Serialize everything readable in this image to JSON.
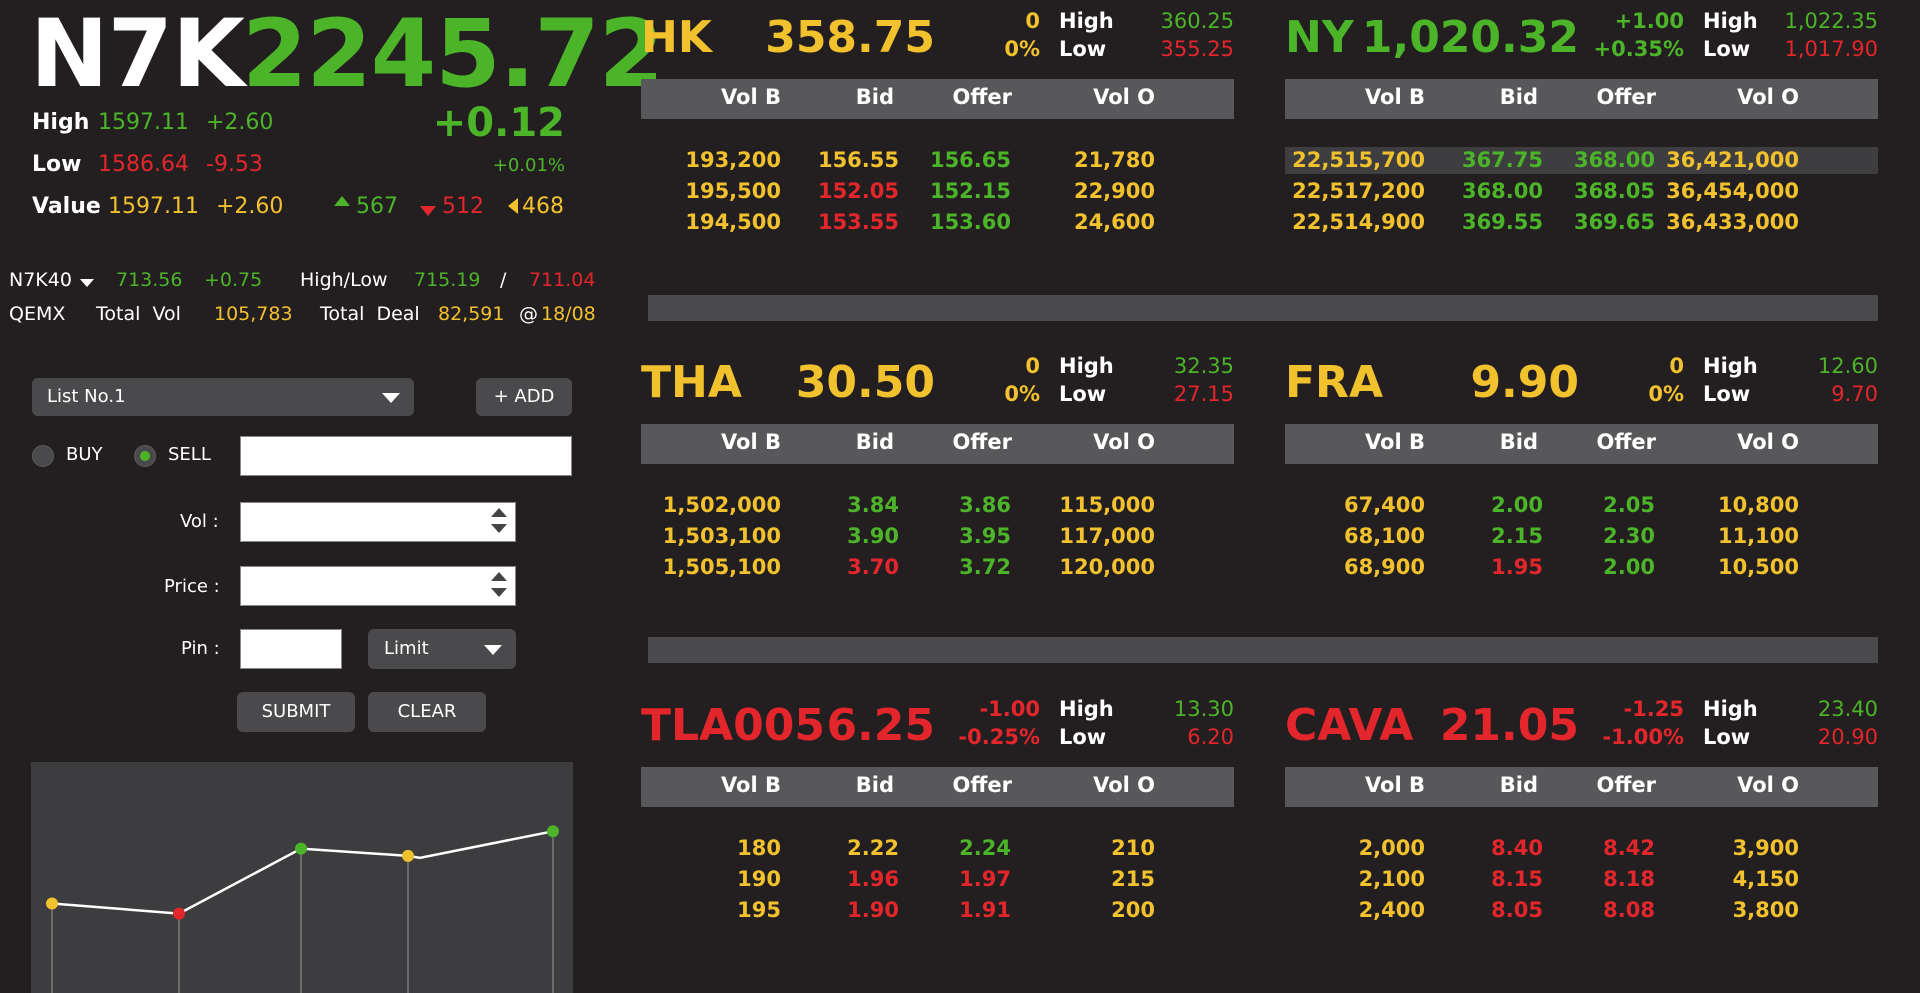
{
  "index": {
    "name": "N7K",
    "value": "2245.72",
    "change": "+0.12",
    "change_pct": "+0.01%",
    "high_label": "High",
    "high_value": "1597.11",
    "high_change": "+2.60",
    "low_label": "Low",
    "low_value": "1586.64",
    "low_change": "-9.53",
    "value_label": "Value",
    "value_value": "1597.11",
    "value_change": "+2.60",
    "up_count": "567",
    "down_count": "512",
    "unch_count": "468"
  },
  "sub_index": {
    "name": "N7K40",
    "value": "713.56",
    "change": "+0.75",
    "highlow_label": "High/Low",
    "high": "715.19",
    "slash": "/",
    "low": "711.04",
    "row2_name": "QEMX",
    "total_vol_label": "Total  Vol",
    "total_vol": "105,783",
    "total_deal_label": "Total  Deal",
    "total_deal": "82,591",
    "at": "@",
    "date": "18/08"
  },
  "order_form": {
    "list_select": "List No.1",
    "add_button": "+ ADD",
    "buy_label": "BUY",
    "sell_label": "SELL",
    "selected_side": "SELL",
    "vol_label": "Vol :",
    "price_label": "Price :",
    "pin_label": "Pin :",
    "order_type": "Limit",
    "submit_button": "SUBMIT",
    "clear_button": "CLEAR"
  },
  "table_headers": [
    "Vol B",
    "Bid",
    "Offer",
    "Vol O"
  ],
  "markets": [
    {
      "symbol": "HK",
      "price": "358.75",
      "change": "0",
      "change_pct": "0%",
      "high_label": "High",
      "high": "360.25",
      "low_label": "Low",
      "low": "355.25",
      "sym_color": "#f2c12e",
      "price_color": "#f2c12e",
      "change_color": "#f2c12e",
      "rows": [
        {
          "volb": "193,200",
          "bid": "156.55",
          "offer": "156.65",
          "volo": "21,780",
          "bid_color": "#f2c12e",
          "offer_color": "#4cb428"
        },
        {
          "volb": "195,500",
          "bid": "152.05",
          "offer": "152.15",
          "volo": "22,900",
          "bid_color": "#e3262b",
          "offer_color": "#4cb428"
        },
        {
          "volb": "194,500",
          "bid": "153.55",
          "offer": "153.60",
          "volo": "24,600",
          "bid_color": "#e3262b",
          "offer_color": "#4cb428"
        }
      ]
    },
    {
      "symbol": "NY",
      "price": "1,020.32",
      "change": "+1.00",
      "change_pct": "+0.35%",
      "high_label": "High",
      "high": "1,022.35",
      "low_label": "Low",
      "low": "1,017.90",
      "sym_color": "#4cb428",
      "price_color": "#4cb428",
      "change_color": "#4cb428",
      "rows": [
        {
          "volb": "22,515,700",
          "bid": "367.75",
          "offer": "368.00",
          "volo": "36,421,000",
          "bid_color": "#4cb428",
          "offer_color": "#4cb428",
          "highlight": true
        },
        {
          "volb": "22,517,200",
          "bid": "368.00",
          "offer": "368.05",
          "volo": "36,454,000",
          "bid_color": "#4cb428",
          "offer_color": "#4cb428"
        },
        {
          "volb": "22,514,900",
          "bid": "369.55",
          "offer": "369.65",
          "volo": "36,433,000",
          "bid_color": "#4cb428",
          "offer_color": "#4cb428"
        }
      ]
    },
    {
      "symbol": "THA",
      "price": "30.50",
      "change": "0",
      "change_pct": "0%",
      "high_label": "High",
      "high": "32.35",
      "low_label": "Low",
      "low": "27.15",
      "sym_color": "#f2c12e",
      "price_color": "#f2c12e",
      "change_color": "#f2c12e",
      "rows": [
        {
          "volb": "1,502,000",
          "bid": "3.84",
          "offer": "3.86",
          "volo": "115,000",
          "bid_color": "#4cb428",
          "offer_color": "#4cb428"
        },
        {
          "volb": "1,503,100",
          "bid": "3.90",
          "offer": "3.95",
          "volo": "117,000",
          "bid_color": "#4cb428",
          "offer_color": "#4cb428"
        },
        {
          "volb": "1,505,100",
          "bid": "3.70",
          "offer": "3.72",
          "volo": "120,000",
          "bid_color": "#e3262b",
          "offer_color": "#4cb428"
        }
      ]
    },
    {
      "symbol": "FRA",
      "price": "9.90",
      "change": "0",
      "change_pct": "0%",
      "high_label": "High",
      "high": "12.60",
      "low_label": "Low",
      "low": "9.70",
      "sym_color": "#f2c12e",
      "price_color": "#f2c12e",
      "change_color": "#f2c12e",
      "rows": [
        {
          "volb": "67,400",
          "bid": "2.00",
          "offer": "2.05",
          "volo": "10,800",
          "bid_color": "#4cb428",
          "offer_color": "#4cb428"
        },
        {
          "volb": "68,100",
          "bid": "2.15",
          "offer": "2.30",
          "volo": "11,100",
          "bid_color": "#4cb428",
          "offer_color": "#4cb428"
        },
        {
          "volb": "68,900",
          "bid": "1.95",
          "offer": "2.00",
          "volo": "10,500",
          "bid_color": "#e3262b",
          "offer_color": "#4cb428"
        }
      ]
    },
    {
      "symbol": "TLA005",
      "price": "6.25",
      "change": "-1.00",
      "change_pct": "-0.25%",
      "high_label": "High",
      "high": "13.30",
      "low_label": "Low",
      "low": "6.20",
      "sym_color": "#e3262b",
      "price_color": "#e3262b",
      "change_color": "#e3262b",
      "rows": [
        {
          "volb": "180",
          "bid": "2.22",
          "offer": "2.24",
          "volo": "210",
          "bid_color": "#f2c12e",
          "offer_color": "#4cb428"
        },
        {
          "volb": "190",
          "bid": "1.96",
          "offer": "1.97",
          "volo": "215",
          "bid_color": "#e3262b",
          "offer_color": "#e3262b"
        },
        {
          "volb": "195",
          "bid": "1.90",
          "offer": "1.91",
          "volo": "200",
          "bid_color": "#e3262b",
          "offer_color": "#e3262b"
        }
      ]
    },
    {
      "symbol": "CAVA",
      "price": "21.05",
      "change": "-1.25",
      "change_pct": "-1.00%",
      "high_label": "High",
      "high": "23.40",
      "low_label": "Low",
      "low": "20.90",
      "sym_color": "#e3262b",
      "price_color": "#e3262b",
      "change_color": "#e3262b",
      "rows": [
        {
          "volb": "2,000",
          "bid": "8.40",
          "offer": "8.42",
          "volo": "3,900",
          "bid_color": "#e3262b",
          "offer_color": "#e3262b"
        },
        {
          "volb": "2,100",
          "bid": "8.15",
          "offer": "8.18",
          "volo": "4,150",
          "bid_color": "#e3262b",
          "offer_color": "#e3262b"
        },
        {
          "volb": "2,400",
          "bid": "8.05",
          "offer": "8.08",
          "volo": "3,800",
          "bid_color": "#e3262b",
          "offer_color": "#e3262b"
        }
      ]
    }
  ],
  "colors": {
    "up": "#4cb428",
    "down": "#e3262b",
    "unchanged": "#f2c12e",
    "background": "#231f20"
  },
  "chart_data": {
    "type": "line",
    "x": [
      1,
      2,
      3,
      4,
      5
    ],
    "values": [
      62,
      55,
      100,
      95,
      112
    ],
    "point_colors": [
      "#f2c12e",
      "#e3262b",
      "#4cb428",
      "#f2c12e",
      "#4cb428"
    ],
    "title": "",
    "xlabel": "",
    "ylabel": "",
    "ylim": [
      0,
      160
    ],
    "grid": false
  }
}
